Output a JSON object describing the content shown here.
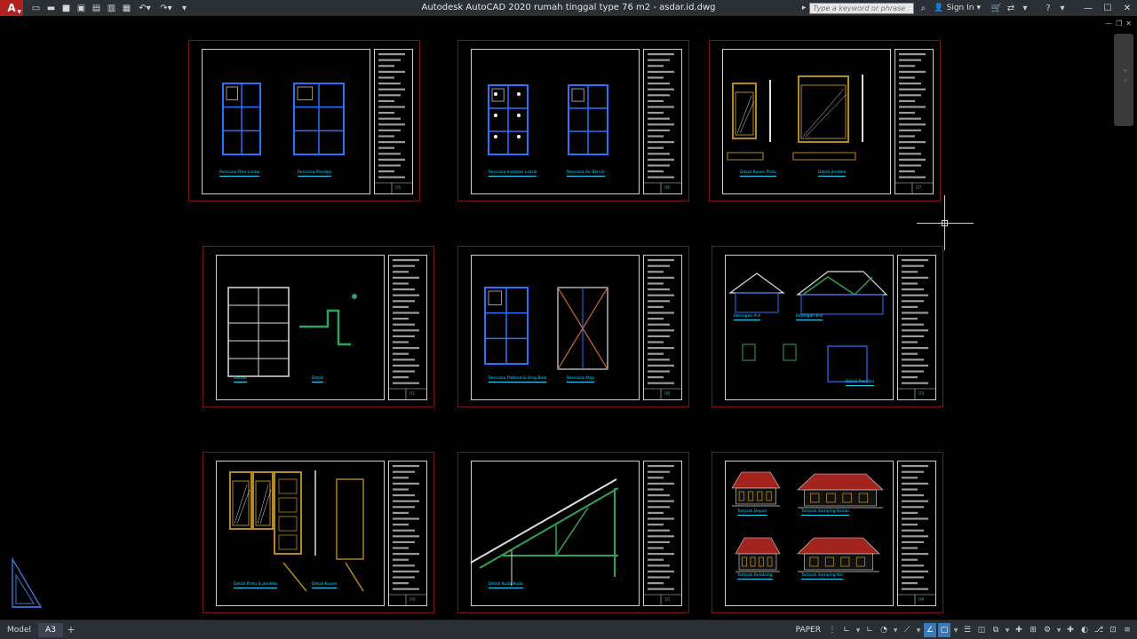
{
  "app": {
    "logo_letter": "A",
    "title": "Autodesk AutoCAD 2020    rumah tinggal type 76 m2 - asdar.id.dwg"
  },
  "search": {
    "placeholder": "Type a keyword or phrase"
  },
  "user": {
    "sign_in_label": "Sign In"
  },
  "layout_tabs": [
    {
      "label": "Model",
      "active": false
    },
    {
      "label": "A3",
      "active": true
    }
  ],
  "status": {
    "paper_label": "PAPER"
  },
  "sheets": [
    {
      "id": "sheet-1",
      "captions": [
        "Rencana Pola Lantai",
        "Rencana Pondasi"
      ],
      "sheet_no": "05"
    },
    {
      "id": "sheet-2",
      "captions": [
        "Rencana Instalasi Listrik",
        "Rencana Air Bersih"
      ],
      "sheet_no": "06"
    },
    {
      "id": "sheet-3",
      "captions": [
        "Detail Kusen Pintu",
        "Detail Jendela"
      ],
      "sheet_no": "07"
    },
    {
      "id": "sheet-4",
      "captions": [
        "Denah",
        "Detail"
      ],
      "sheet_no": "01"
    },
    {
      "id": "sheet-5",
      "captions": [
        "Rencana Plafond & Ring Balk",
        "Rencana Atap"
      ],
      "sheet_no": "08"
    },
    {
      "id": "sheet-6",
      "captions": [
        "Potongan A-A",
        "Potongan B-B",
        "Detail Pondasi"
      ],
      "sheet_no": "03"
    },
    {
      "id": "sheet-7",
      "captions": [
        "Detail Pintu & Jendela",
        "Detail Kusen"
      ],
      "sheet_no": "09"
    },
    {
      "id": "sheet-8",
      "captions": [
        "Detail Kuda-Kuda"
      ],
      "sheet_no": "10"
    },
    {
      "id": "sheet-9",
      "captions": [
        "Tampak Depan",
        "Tampak Samping Kanan",
        "Tampak Belakang",
        "Tampak Samping Kiri"
      ],
      "sheet_no": "04"
    }
  ],
  "colors": {
    "sheet_border": "#7a1515",
    "plan_blue": "#2f6fff",
    "caption_cyan": "#18d7ff",
    "roof_red": "#a3241c",
    "wood_yellow": "#b38a1f",
    "structure_green": "#2fa35a"
  },
  "icons": {
    "new": "new-file-icon",
    "open": "open-folder-icon",
    "save": "save-icon",
    "plot": "plot-icon",
    "undo": "undo-icon",
    "redo": "redo-icon",
    "search": "search-icon",
    "user": "user-icon",
    "cart": "cart-icon",
    "help": "help-icon"
  }
}
